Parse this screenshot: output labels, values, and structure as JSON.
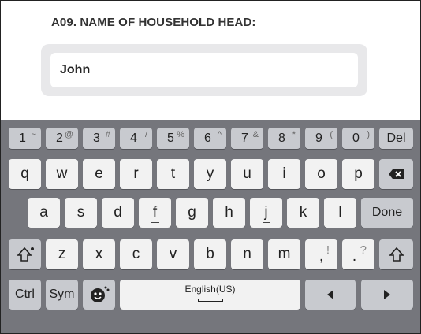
{
  "form": {
    "question_label": "A09. NAME OF HOUSEHOLD HEAD:",
    "field_value": "John"
  },
  "keyboard": {
    "number_row": [
      {
        "main": "1",
        "sup": "~"
      },
      {
        "main": "2",
        "sup": "@"
      },
      {
        "main": "3",
        "sup": "#"
      },
      {
        "main": "4",
        "sup": "/"
      },
      {
        "main": "5",
        "sup": "%"
      },
      {
        "main": "6",
        "sup": "^"
      },
      {
        "main": "7",
        "sup": "&"
      },
      {
        "main": "8",
        "sup": "*"
      },
      {
        "main": "9",
        "sup": "("
      },
      {
        "main": "0",
        "sup": ")"
      }
    ],
    "del_label": "Del",
    "row_q": [
      "q",
      "w",
      "e",
      "r",
      "t",
      "y",
      "u",
      "i",
      "o",
      "p"
    ],
    "row_a": [
      "a",
      "s",
      "d",
      "f",
      "g",
      "h",
      "j",
      "k",
      "l"
    ],
    "done_label": "Done",
    "row_z": [
      "z",
      "x",
      "c",
      "v",
      "b",
      "n",
      "m"
    ],
    "comma": {
      "main": ",",
      "sup": "!"
    },
    "period": {
      "main": ".",
      "sup": "?"
    },
    "ctrl_label": "Ctrl",
    "sym_label": "Sym",
    "space_label": "English(US)",
    "icons": {
      "backspace": "backspace-icon",
      "shift": "shift-icon",
      "emoji": "emoji-icon",
      "left": "arrow-left-icon",
      "right": "arrow-right-icon"
    }
  }
}
